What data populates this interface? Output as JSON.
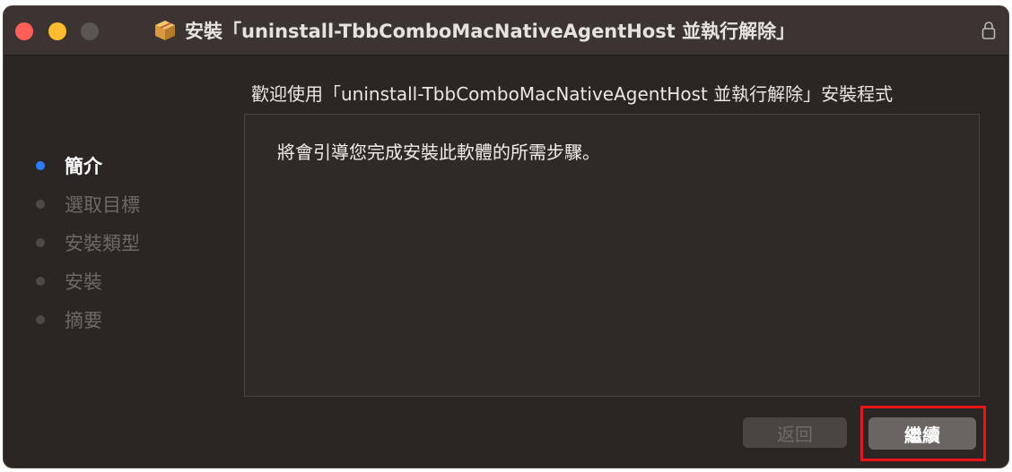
{
  "window": {
    "title": "安裝「uninstall-TbbComboMacNativeAgentHost 並執行解除」",
    "title_icon": "package-icon",
    "lock_icon": "lock-icon"
  },
  "welcome_heading": "歡迎使用「uninstall-TbbComboMacNativeAgentHost 並執行解除」安裝程式",
  "intro_text": "將會引導您完成安裝此軟體的所需步驟。",
  "steps": [
    {
      "label": "簡介",
      "active": true
    },
    {
      "label": "選取目標",
      "active": false
    },
    {
      "label": "安裝類型",
      "active": false
    },
    {
      "label": "安裝",
      "active": false
    },
    {
      "label": "摘要",
      "active": false
    }
  ],
  "buttons": {
    "back": "返回",
    "continue": "繼續"
  },
  "colors": {
    "accent": "#2f7df6",
    "highlight": "#e8161b"
  }
}
